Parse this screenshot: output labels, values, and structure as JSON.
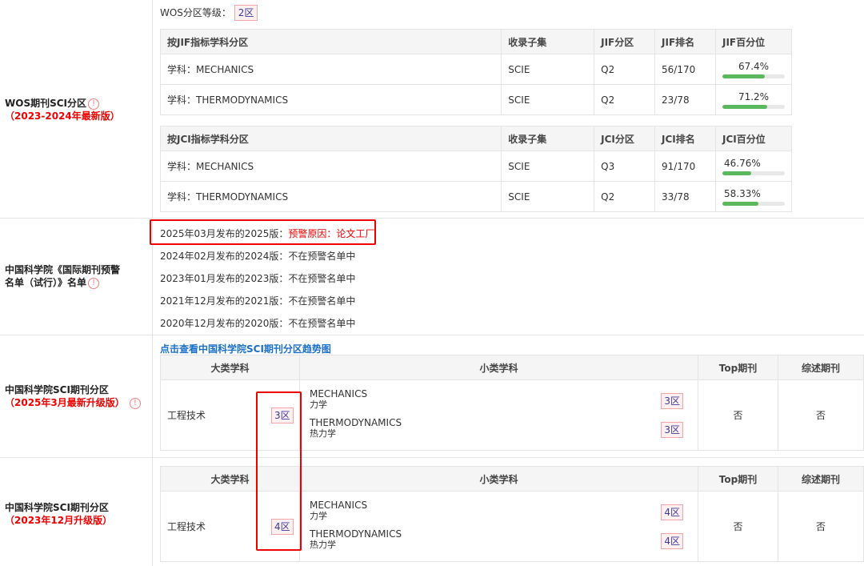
{
  "wos": {
    "level_label": "WOS分区等级：",
    "level_value": "2区",
    "left_title": "WOS期刊SCI分区",
    "left_sub": "（2023-2024年最新版）",
    "info_glyph": "!",
    "jif_headers": [
      "按JIF指标学科分区",
      "收录子集",
      "JIF分区",
      "JIF排名",
      "JIF百分位"
    ],
    "jif_rows": [
      {
        "subject": "学科：MECHANICS",
        "set": "SCIE",
        "zone": "Q2",
        "rank": "56/170",
        "pct": "67.4%",
        "pct_value": 67.4
      },
      {
        "subject": "学科：THERMODYNAMICS",
        "set": "SCIE",
        "zone": "Q2",
        "rank": "23/78",
        "pct": "71.2%",
        "pct_value": 71.2
      }
    ],
    "jci_headers": [
      "按JCI指标学科分区",
      "收录子集",
      "JCI分区",
      "JCI排名",
      "JCI百分位"
    ],
    "jci_rows": [
      {
        "subject": "学科：MECHANICS",
        "set": "SCIE",
        "zone": "Q3",
        "rank": "91/170",
        "pct": "46.76%",
        "pct_value": 46.76
      },
      {
        "subject": "学科：THERMODYNAMICS",
        "set": "SCIE",
        "zone": "Q2",
        "rank": "33/78",
        "pct": "58.33%",
        "pct_value": 58.33
      }
    ],
    "bar_color": "#5cb85c"
  },
  "warning": {
    "left_title_1": "中国科学院《国际期刊预警",
    "left_title_2": "名单（试行）》名单",
    "lines": [
      {
        "prefix": "2025年03月发布的2025版：",
        "status": "预警原因：论文工厂",
        "highlight": true
      },
      {
        "prefix": "2024年02月发布的2024版：",
        "status": "不在预警名单中",
        "highlight": false
      },
      {
        "prefix": "2023年01月发布的2023版：",
        "status": "不在预警名单中",
        "highlight": false
      },
      {
        "prefix": "2021年12月发布的2021版：",
        "status": "不在预警名单中",
        "highlight": false
      },
      {
        "prefix": "2020年12月发布的2020版：",
        "status": "不在预警名单中",
        "highlight": false
      }
    ],
    "red_color": "#e00000"
  },
  "cas2025": {
    "trend_link": "点击查看中国科学院SCI期刊分区趋势图",
    "left_title": "中国科学院SCI期刊分区",
    "left_sub": "（2025年3月最新升级版）",
    "headers": [
      "大类学科",
      "小类学科",
      "Top期刊",
      "综述期刊"
    ],
    "major": "工程技术",
    "major_zone": "3区",
    "subjects": [
      {
        "en": "MECHANICS",
        "cn": "力学",
        "zone": "3区"
      },
      {
        "en": "THERMODYNAMICS",
        "cn": "热力学",
        "zone": "3区"
      }
    ],
    "top": "否",
    "review": "否"
  },
  "cas2023": {
    "left_title": "中国科学院SCI期刊分区",
    "left_sub": "（2023年12月升级版）",
    "headers": [
      "大类学科",
      "小类学科",
      "Top期刊",
      "综述期刊"
    ],
    "major": "工程技术",
    "major_zone": "4区",
    "subjects": [
      {
        "en": "MECHANICS",
        "cn": "力学",
        "zone": "4区"
      },
      {
        "en": "THERMODYNAMICS",
        "cn": "热力学",
        "zone": "4区"
      }
    ],
    "top": "否",
    "review": "否"
  }
}
